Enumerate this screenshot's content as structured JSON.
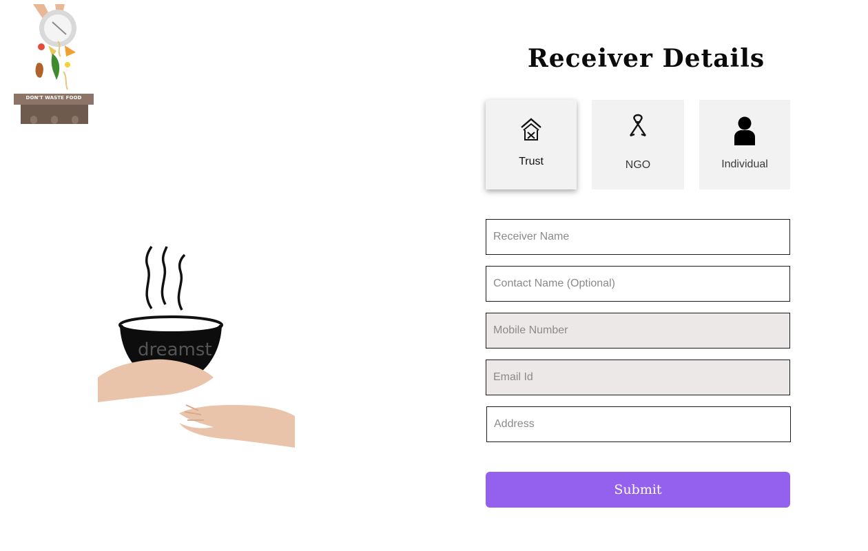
{
  "logo": {
    "banner_text": "DON'T WASTE FOOD",
    "icon": "dont-waste-food-logo"
  },
  "illustration": {
    "watermark": "dreamst",
    "icon": "hands-serving-food-bowl"
  },
  "form": {
    "title": "Receiver Details",
    "receiver_types": [
      {
        "label": "Trust",
        "icon": "trust-building-icon",
        "selected": true
      },
      {
        "label": "NGO",
        "icon": "ngo-ribbon-icon",
        "selected": false
      },
      {
        "label": "Individual",
        "icon": "person-icon",
        "selected": false
      }
    ],
    "fields": {
      "receiver_name": {
        "placeholder": "Receiver Name",
        "value": ""
      },
      "contact_name": {
        "placeholder": "Contact Name (Optional)",
        "value": ""
      },
      "mobile_number": {
        "placeholder": "Mobile Number",
        "value": ""
      },
      "email_id": {
        "placeholder": "Email Id",
        "value": ""
      },
      "address": {
        "placeholder": "Address",
        "value": ""
      }
    },
    "submit_label": "Submit"
  },
  "colors": {
    "accent": "#9461ee",
    "card_background": "#f2f2f2",
    "shaded_field_background": "#ece8e7",
    "hand_color": "#e9c3aa"
  }
}
